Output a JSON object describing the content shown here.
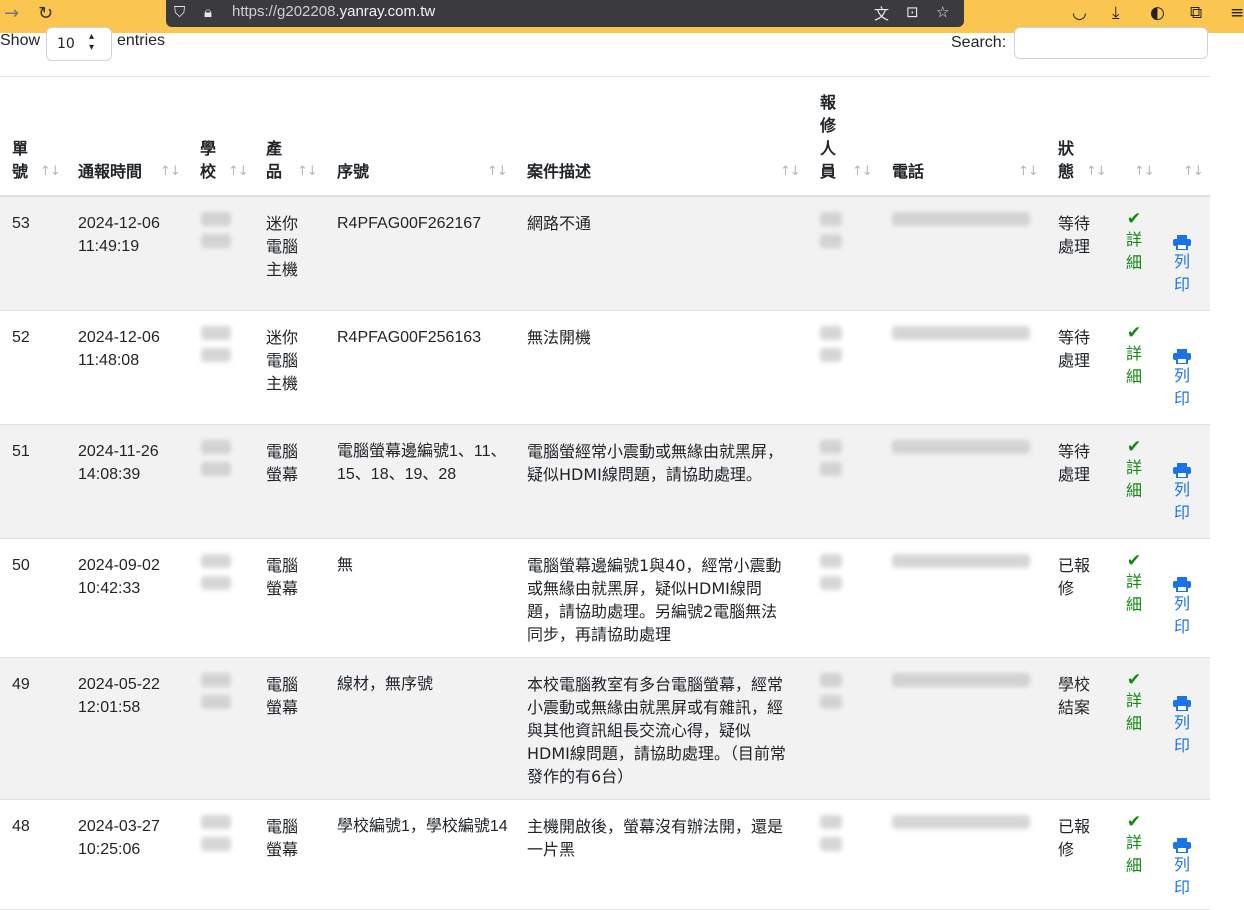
{
  "browser": {
    "url_scheme": "https://",
    "url_sub": "g202208.",
    "url_host": "yanray.com.tw"
  },
  "table_controls": {
    "show_label": "Show",
    "entries_label": "entries",
    "page_length": "10",
    "search_label": "Search:",
    "search_value": ""
  },
  "columns": [
    "單號",
    "通報時間",
    "學校",
    "產品",
    "序號",
    "案件描述",
    "報修人員",
    "電話",
    "狀態",
    "",
    ""
  ],
  "actions": {
    "detail_label": "詳細",
    "print_label": "列印"
  },
  "rows": [
    {
      "id": "53",
      "date": "2024-12-06",
      "time": "11:49:19",
      "product": "迷你電腦主機",
      "serial": "R4PFAG00F262167",
      "description": "網路不通",
      "status": "等待處理"
    },
    {
      "id": "52",
      "date": "2024-12-06",
      "time": "11:48:08",
      "product": "迷你電腦主機",
      "serial": "R4PFAG00F256163",
      "description": "無法開機",
      "status": "等待處理"
    },
    {
      "id": "51",
      "date": "2024-11-26",
      "time": "14:08:39",
      "product": "電腦螢幕",
      "serial": "電腦螢幕邊編號1、11、15、18、19、28",
      "description": "電腦螢經常小震動或無緣由就黑屏，疑似HDMI線問題，請協助處理。",
      "status": "等待處理"
    },
    {
      "id": "50",
      "date": "2024-09-02",
      "time": "10:42:33",
      "product": "電腦螢幕",
      "serial": "無",
      "description": "電腦螢幕邊編號1與40，經常小震動或無緣由就黑屏，疑似HDMI線問題，請協助處理。另編號2電腦無法同步，再請協助處理",
      "status": "已報修"
    },
    {
      "id": "49",
      "date": "2024-05-22",
      "time": "12:01:58",
      "product": "電腦螢幕",
      "serial": "線材，無序號",
      "description": "本校電腦教室有多台電腦螢幕，經常小震動或無緣由就黑屏或有雜訊，經與其他資訊組長交流心得，疑似HDMI線問題，請協助處理。（目前常發作的有6台）",
      "status": "學校結案"
    },
    {
      "id": "48",
      "date": "2024-03-27",
      "time": "10:25:06",
      "product": "電腦螢幕",
      "serial": "學校編號1，學校編號14",
      "description": "主機開啟後，螢幕沒有辦法開，還是一片黑",
      "status": "已報修"
    }
  ]
}
